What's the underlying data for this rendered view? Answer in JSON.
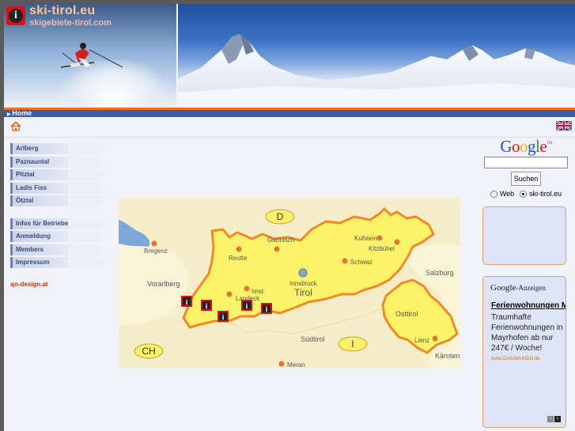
{
  "header": {
    "site_title": "ski-tirol.eu",
    "site_subtitle": "skigebiete-tirol.com"
  },
  "navbar": {
    "home_label": "Home"
  },
  "sidebar": {
    "group1": [
      {
        "label": "Arlberg"
      },
      {
        "label": "Paznauntal"
      },
      {
        "label": "Pitztal"
      },
      {
        "label": "Ladis Fiss Serfaus"
      },
      {
        "label": "Ötztal"
      }
    ],
    "group2": [
      {
        "label": "Infos für Betriebe"
      },
      {
        "label": "Anmeldung"
      },
      {
        "label": "Members"
      },
      {
        "label": "Impressum"
      }
    ],
    "design_link": "qn-design.at"
  },
  "map": {
    "country_badges": {
      "D": "D",
      "CH": "CH",
      "I": "I"
    },
    "region_label": "Tirol",
    "osttirol_label": "Osttirol",
    "places": [
      {
        "name": "Bregenz"
      },
      {
        "name": "Garmisch"
      },
      {
        "name": "Reutte"
      },
      {
        "name": "Kufstein"
      },
      {
        "name": "Kitzbühel"
      },
      {
        "name": "Schwaz"
      },
      {
        "name": "Innsbruck"
      },
      {
        "name": "Imst"
      },
      {
        "name": "Landeck"
      },
      {
        "name": "Lienz"
      },
      {
        "name": "Meran"
      }
    ],
    "regions": {
      "vorarlberg": "Vorarlberg",
      "salzburg": "Salzburg",
      "suedtirol": "Südtirol",
      "kaernten": "Kärnten"
    }
  },
  "search": {
    "logo_text": "Google",
    "logo_tm": "TM",
    "button_label": "Suchen",
    "option_web": "Web",
    "option_site": "ski-tirol.eu",
    "input_value": ""
  },
  "ads": {
    "header_brand": "Google",
    "header_suffix": "-Anzeigen",
    "title": "Ferienwohnungen Mayrhofen",
    "text": "Traumhafte Ferienwohnungen in Mayrhofen ab nur 247€ / Woche!",
    "url": "www.CASAMUNDO.de"
  },
  "colors": {
    "nav_blue": "#3a5ea8",
    "accent_orange": "#e87020",
    "map_tirol": "#fdf36b",
    "map_border": "#f08a28"
  }
}
